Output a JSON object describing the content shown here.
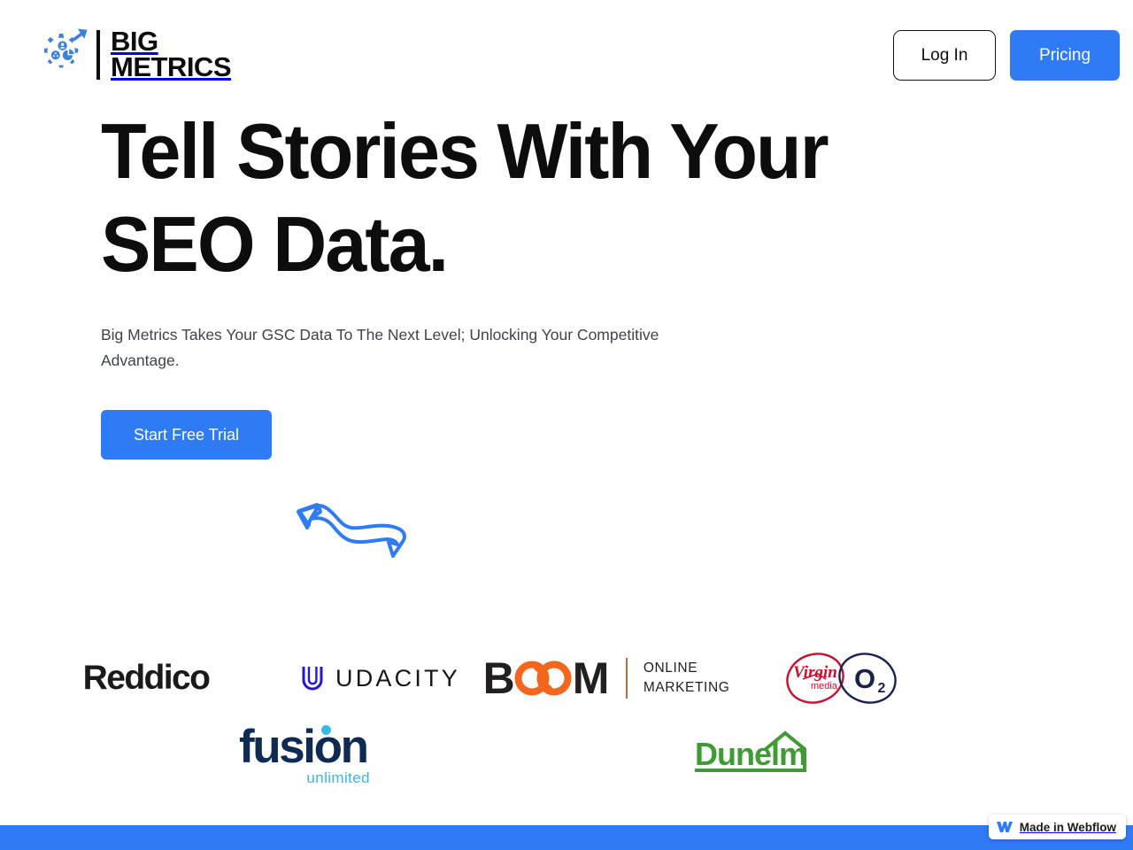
{
  "brand": {
    "icon_name": "big-metrics-gear-logo",
    "line1": "BIG",
    "line2": "METRICS"
  },
  "header": {
    "login_label": "Log In",
    "pricing_label": "Pricing"
  },
  "hero": {
    "title_line1": "Tell Stories With Your",
    "title_line2": "SEO Data.",
    "subtitle": "Big Metrics Takes Your GSC Data To The Next Level; Unlocking Your Competitive Advantage.",
    "cta_label": "Start Free Trial",
    "doodle_name": "hand-drawn-arrow"
  },
  "logos": {
    "row1": [
      {
        "name": "reddico",
        "text": "Reddico"
      },
      {
        "name": "udacity",
        "text": "UDACITY"
      },
      {
        "name": "boom-online-marketing",
        "mark": "B",
        "mark2": "M",
        "line1": "ONLINE",
        "line2": "MARKETING"
      },
      {
        "name": "virgin-media-o2",
        "text": "Virgin media",
        "text2": "O2"
      }
    ],
    "row2": [
      {
        "name": "fusion-unlimited",
        "text": "fusion",
        "sub": "unlimited"
      },
      {
        "name": "dunelm",
        "text": "Dunelm"
      }
    ]
  },
  "footer": {
    "webflow_label": "Made in Webflow",
    "webflow_icon": "webflow-logo-icon",
    "bar_color": "#2f7bf6"
  },
  "colors": {
    "accent_blue": "#2f7bf6",
    "ink": "#0d0d0d",
    "body_text": "#3d4451",
    "udacity_blue": "#2015d9",
    "boom_orange": "#f4661b",
    "virgin_red": "#c8102e",
    "o2_navy": "#19224f",
    "fusion_navy": "#0f2b53",
    "fusion_cyan": "#39b7e8",
    "dunelm_green": "#3f9c35"
  }
}
